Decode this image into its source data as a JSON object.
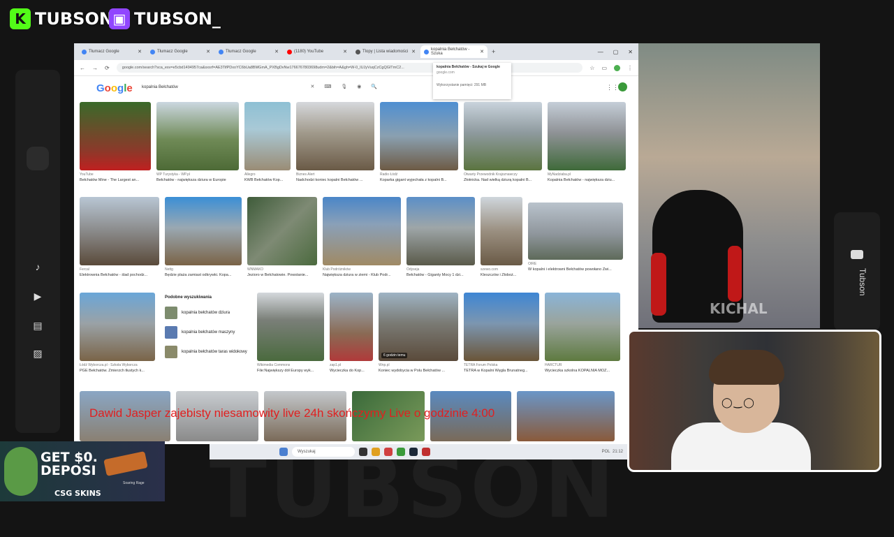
{
  "overlay": {
    "kick_name": "TUBSON",
    "twitch_name": "TUBSON_",
    "side_channel": "Tubson",
    "watermark": "TUBSON",
    "webcam_watermark": "KICHAL",
    "ticker": "Dawid Jasper zajebisty niesamowity live 24h skończymy Live o godzinie 4:00"
  },
  "browser": {
    "tabs": [
      {
        "label": "Tłumacz Google",
        "active": false
      },
      {
        "label": "Tłumacz Google",
        "active": false
      },
      {
        "label": "Tłumacz Google",
        "active": false
      },
      {
        "label": "(1180) YouTube",
        "active": false
      },
      {
        "label": "Tlopy | Lista wiadomości",
        "active": false
      },
      {
        "label": "kopalnia Bełchatów - Szuka",
        "active": true
      }
    ],
    "url": "google.com/search?sca_esv=e5cbd1494957ca&sxsrf=AE3TifPDxoYC6bUa8BMGmA_PXBgDvNw1766767803698udm=2&bih=A&gh=W-0_IUJyVuqCzCgQGlTmC2...",
    "logo": "Google",
    "query": "kopalnia Bełchatów",
    "dropdown_title": "kopalnia Bełchatów - Szukaj w Google",
    "dropdown_domain": "google.com",
    "dropdown_memory": "Wykorzystanie pamięci: 291 MB",
    "related_title": "Podobne wyszukiwania",
    "related": [
      "kopalnia bełchatów dziura",
      "kopalnia bełchatów maszyny",
      "kopalnia bełchatów taras widokowy"
    ],
    "row1": [
      {
        "src": "YouTube",
        "title": "Bełchatów Mine - The Largest an..."
      },
      {
        "src": "WP Turystyka - WP.pl",
        "title": "Bełchatów - największa dziura w Europie"
      },
      {
        "src": "Allegro",
        "title": "KWB Bełchatów Kop..."
      },
      {
        "src": "Biznes Alert",
        "title": "Nadchodzi koniec kopalni Bełchatów ..."
      },
      {
        "src": "Radio Łódź",
        "title": "Koparka gigant wyjechała z kopalni B..."
      },
      {
        "src": "Otwarty Przewodnik Krajoznawczy",
        "title": "Złotnicka. Nad wielką dziurą kopalni B..."
      },
      {
        "src": "MyNadziaba.pl",
        "title": "Kopalnia Bełchatów - największa dziu..."
      }
    ],
    "row2": [
      {
        "src": "Fercal",
        "title": "Elektrownia Bełchatów - ślad pochodz..."
      },
      {
        "src": "Nettg",
        "title": "Będzie plaża zamiast odkrywki. Kopa..."
      },
      {
        "src": "WNMAKO",
        "title": "Jezioro w Bełchatowie. Powstanie..."
      },
      {
        "src": "Klub Podróżników",
        "title": "Największa dziura w ziemi - Klub Podr..."
      },
      {
        "src": "Odyseja",
        "title": "Bełchatów - Giganty Mocy 1 dzi..."
      },
      {
        "src": "szewo.com",
        "title": "Kleszczów i Złoboż..."
      },
      {
        "src": "OIRE",
        "title": "W kopalni i elektrowni Bełchatów powołano Zwi..."
      }
    ],
    "row3": [
      {
        "src": "Łódź Wyborcza.pl - Szkoła Wyborcza",
        "title": "PGE Bełchatów. Zmierzch tłustych k..."
      },
      {
        "src": "Wikimedia Commons",
        "title": "File:Największy dół Europy wyk..."
      },
      {
        "src": "zap1.pl",
        "title": "Wycieczka do Kop..."
      },
      {
        "src": "Wnp.pl",
        "title": "Koniec wydobycia w Polu Bełchatów ..."
      },
      {
        "src": "TETRA Forum Polska",
        "title": "TETRA w Kopalni Węgla Brunatneg..."
      },
      {
        "src": "HARCTUR",
        "title": "Wycieczka szkolna KOPALNIA MOŻ..."
      }
    ],
    "badge_time": "6 godzin temu"
  },
  "taskbar": {
    "search_placeholder": "Wyszukaj",
    "lang": "POL",
    "time": "21:12"
  },
  "promo": {
    "line1": "GET $0.",
    "line2": "DEPOSI",
    "brand": "CSG SKINS",
    "tag": "Soaring Rage"
  }
}
